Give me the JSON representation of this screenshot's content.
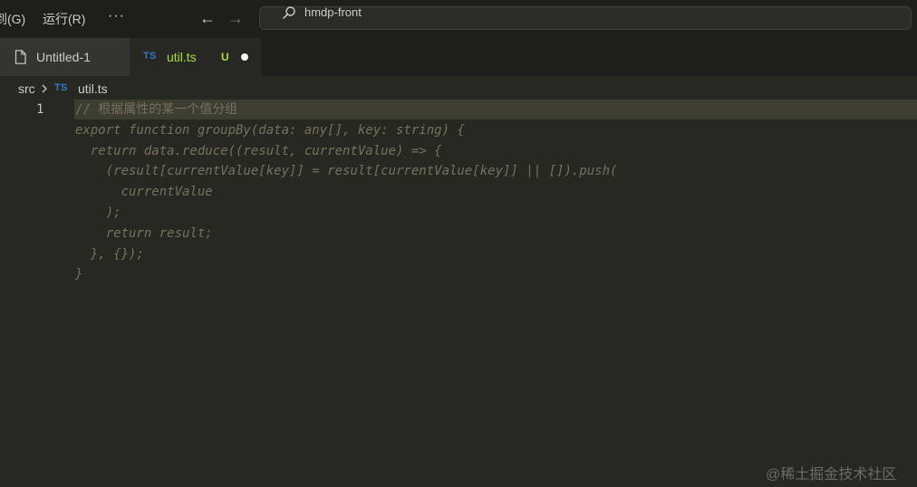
{
  "titlebar": {
    "menu": [
      {
        "label": "到(G)"
      },
      {
        "label": "运行(R)"
      }
    ],
    "more_label": "···",
    "back_arrow": "←",
    "forward_arrow": "→",
    "search": {
      "text": "hmdp-front",
      "icon": "search-icon"
    }
  },
  "tabs": [
    {
      "label": "Untitled-1",
      "icon": "file-icon",
      "active": false
    },
    {
      "label": "util.ts",
      "icon": "ts-icon",
      "icon_text": "TS",
      "active": true,
      "git_status": "U",
      "dirty": true
    }
  ],
  "breadcrumb": {
    "folder": "src",
    "file_icon_text": "TS",
    "file": "util.ts"
  },
  "editor": {
    "line_numbers": [
      "1"
    ],
    "lines": [
      "// 根据属性的某一个值分组",
      "export function groupBy(data: any[], key: string) {",
      "  return data.reduce((result, currentValue) => {",
      "    (result[currentValue[key]] = result[currentValue[key]] || []).push(",
      "      currentValue",
      "    );",
      "    return result;",
      "  }, {});",
      "}"
    ]
  },
  "watermark": "@稀土掘金技术社区",
  "colors": {
    "editor_bg": "#272822",
    "titlebar_bg": "#1e1f1c",
    "current_line": "#3e3d32",
    "code_ghost": "#75715e",
    "ts_blue": "#3178c6",
    "git_untracked": "#a6e22e",
    "tab_active_text": "#a6e22e"
  }
}
